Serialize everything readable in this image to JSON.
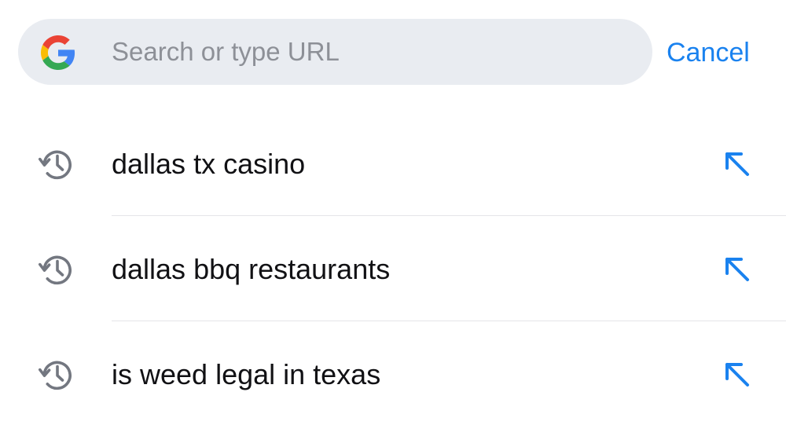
{
  "search": {
    "placeholder": "Search or type URL",
    "value": "",
    "engine_icon": "google-g-icon"
  },
  "header": {
    "cancel_label": "Cancel"
  },
  "suggestions": [
    {
      "label": "dallas tx casino",
      "type_icon": "history-icon",
      "action_icon": "fill-search-arrow-icon"
    },
    {
      "label": "dallas bbq restaurants",
      "type_icon": "history-icon",
      "action_icon": "fill-search-arrow-icon"
    },
    {
      "label": "is weed legal in texas",
      "type_icon": "history-icon",
      "action_icon": "fill-search-arrow-icon"
    }
  ],
  "colors": {
    "accent": "#1a82ef",
    "search_bar_bg": "#e9ecf1",
    "placeholder": "#8d9097",
    "icon_gray": "#737780",
    "divider": "#e4e5e8"
  }
}
